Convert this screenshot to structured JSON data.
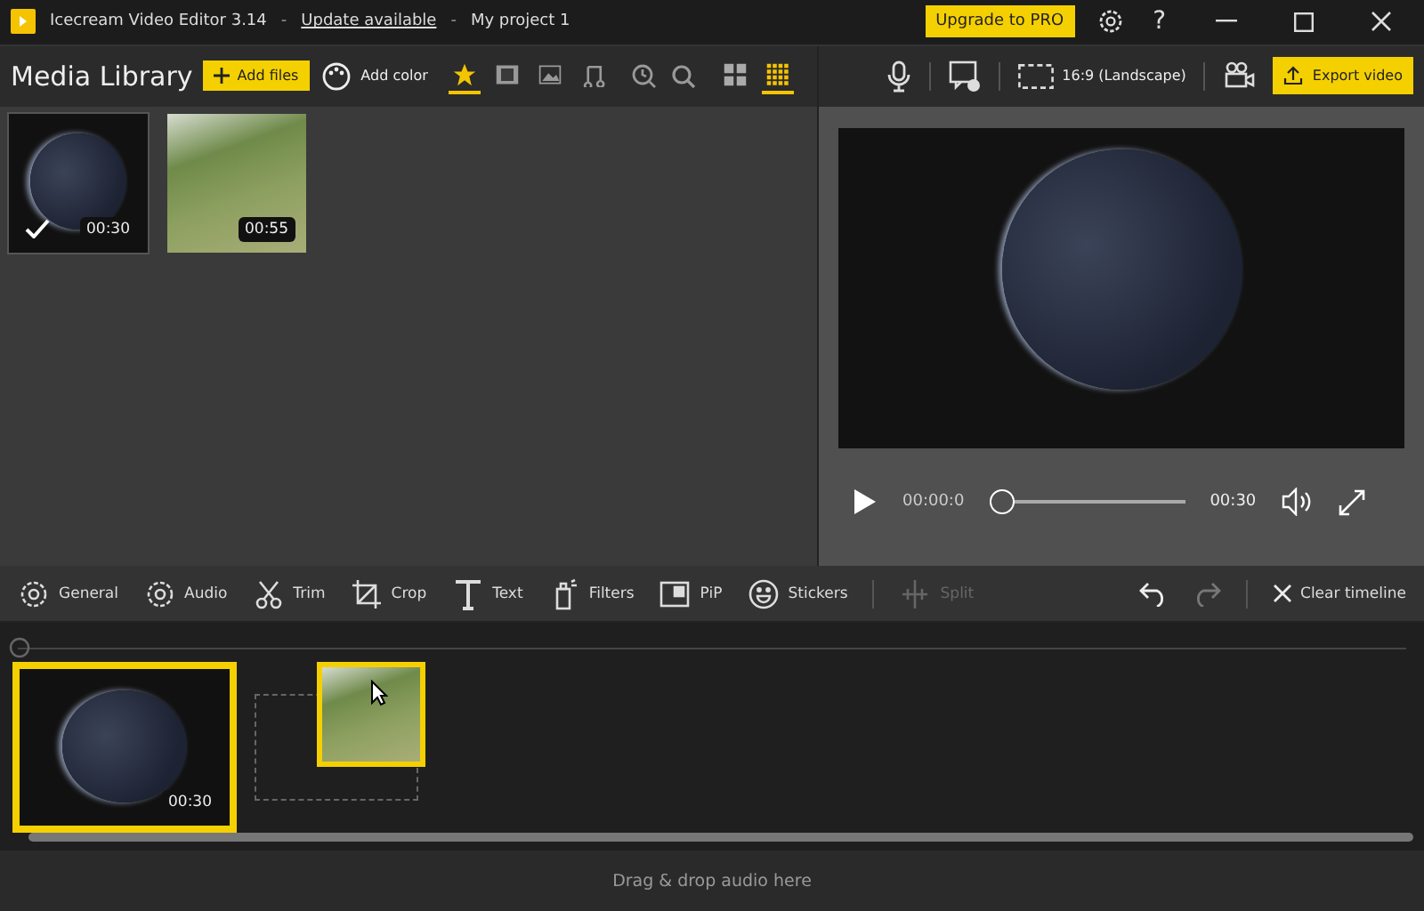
{
  "title_bar": {
    "app_title": "Icecream Video Editor 3.14",
    "update_link": "Update available",
    "separators": [
      "-",
      "-"
    ],
    "project_name": "My project 1",
    "help": "?",
    "upgrade_button": "Upgrade to PRO"
  },
  "media_library": {
    "title": "Media Library",
    "add_files": "Add files",
    "add_color": "Add color",
    "filters": [
      {
        "kind": "star",
        "selected": true
      },
      {
        "kind": "film",
        "selected": false
      },
      {
        "kind": "image",
        "selected": false
      },
      {
        "kind": "music",
        "selected": false
      }
    ],
    "views": [
      {
        "kind": "large",
        "selected": false
      },
      {
        "kind": "small",
        "selected": true
      }
    ],
    "items": [
      {
        "kind": "globe",
        "duration": "00:30",
        "checked": true
      },
      {
        "kind": "field",
        "duration": "00:55",
        "checked": false
      }
    ]
  },
  "preview": {
    "aspect": "16:9 (Landscape)",
    "export_button": "Export video",
    "current_time": "00:00:0",
    "total_time": "00:30",
    "level": 0
  },
  "tools": [
    {
      "kind": "gear",
      "label": "General",
      "disabled": false
    },
    {
      "kind": "gear",
      "label": "Audio",
      "disabled": false
    },
    {
      "kind": "scissors",
      "label": "Trim",
      "disabled": false
    },
    {
      "kind": "crop",
      "label": "Crop",
      "disabled": false
    },
    {
      "kind": "text",
      "label": "Text",
      "disabled": false
    },
    {
      "kind": "spray",
      "label": "Filters",
      "disabled": false
    },
    {
      "kind": "pip",
      "label": "PiP",
      "disabled": false
    },
    {
      "kind": "smile",
      "label": "Stickers",
      "disabled": false
    },
    {
      "kind": "split",
      "label": "Split",
      "disabled": true
    }
  ],
  "clear_timeline": "Clear timeline",
  "timeline": {
    "clips": [
      {
        "kind": "globe",
        "duration": "00:30",
        "selected": true
      }
    ],
    "dragged_clip": {
      "kind": "field"
    }
  },
  "audio_drop": "Drag & drop audio here"
}
